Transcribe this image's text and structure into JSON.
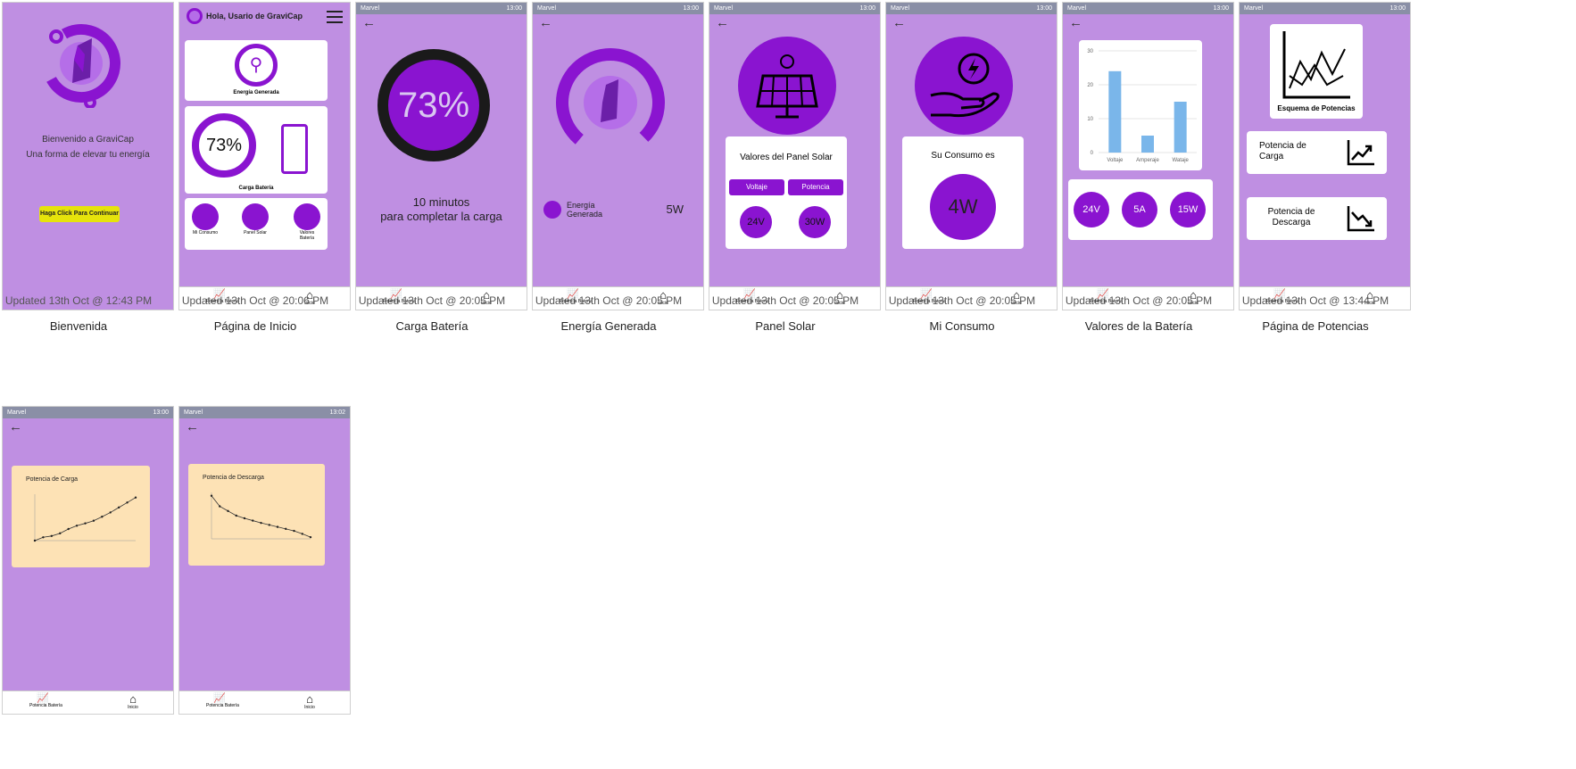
{
  "screens": [
    {
      "updated": "Updated 13th Oct @ 12:43 PM",
      "title": "Bienvenida"
    },
    {
      "updated": "Updated 13th Oct @ 20:06 PM",
      "title": "Página de Inicio"
    },
    {
      "updated": "Updated 13th Oct @ 20:05 PM",
      "title": "Carga Batería"
    },
    {
      "updated": "Updated 13th Oct @ 20:05 PM",
      "title": "Energía Generada"
    },
    {
      "updated": "Updated 13th Oct @ 20:05 PM",
      "title": "Panel Solar"
    },
    {
      "updated": "Updated 13th Oct @ 20:05 PM",
      "title": "Mi Consumo"
    },
    {
      "updated": "Updated 13th Oct @ 20:05 PM",
      "title": "Valores de la Batería"
    },
    {
      "updated": "Updated 13th Oct @ 13:44 PM",
      "title": "Página de Potencias"
    }
  ],
  "statusbar": {
    "carrier": "Marvel",
    "time": "13:00",
    "time2": "13:02"
  },
  "nav": {
    "left": "Potencia Batería",
    "right": "Inicio"
  },
  "welcome": {
    "line1": "Bienvenido a GraviCap",
    "line2": "Una forma de elevar tu energía",
    "button": "Haga Click Para Continuar"
  },
  "home": {
    "greeting": "Hola, Usario de GraviCap",
    "energy_label": "Energía Generada",
    "battery_pct": "73%",
    "battery_label": "Carga Batería",
    "tiles": [
      "Mi Consumo",
      "Panel Solar",
      "Valores Batería"
    ]
  },
  "charge": {
    "pct": "73%",
    "line1": "10 minutos",
    "line2": "para completar la carga"
  },
  "energy": {
    "label1": "Energía",
    "label2": "Generada",
    "value": "5W"
  },
  "solar": {
    "heading": "Valores del Panel Solar",
    "btn_volt": "Voltaje",
    "btn_pow": "Potencia",
    "volt": "24V",
    "pow": "30W"
  },
  "consumo": {
    "heading": "Su Consumo es",
    "value": "4W"
  },
  "bateria": {
    "v": "24V",
    "a": "5A",
    "w": "15W",
    "yticks": [
      "30",
      "20",
      "10",
      "0"
    ],
    "xlabels": [
      "Voltaje",
      "Amperaje",
      "Wataje"
    ]
  },
  "potencias": {
    "esquema": "Esquema de Potencias",
    "carga": "Potencia de Carga",
    "descarga": "Potencia de Descarga"
  },
  "colors": {
    "purple": "#8a14d0",
    "bg": "#bf8fe2",
    "yellow": "#e6e30b",
    "cream": "#fde2b5",
    "bar": "#7ab6ea"
  },
  "chart_data": [
    {
      "type": "bar",
      "categories": [
        "Voltaje",
        "Amperaje",
        "Wataje"
      ],
      "values": [
        24,
        5,
        15
      ],
      "ylim": [
        0,
        30
      ],
      "xlabel": "",
      "ylabel": ""
    },
    {
      "type": "line",
      "title": "Potencia de Carga",
      "x": [
        0,
        1,
        2,
        3,
        4,
        5,
        6,
        7,
        8,
        9,
        10,
        11,
        12
      ],
      "values": [
        0,
        10,
        14,
        22,
        35,
        45,
        52,
        60,
        72,
        85,
        100,
        115,
        130
      ],
      "ylim": [
        0,
        140
      ]
    },
    {
      "type": "line",
      "title": "Potencia de Descarga",
      "x": [
        0,
        1,
        2,
        3,
        4,
        5,
        6,
        7,
        8,
        9,
        10,
        11,
        12
      ],
      "values": [
        130,
        98,
        84,
        70,
        62,
        55,
        48,
        42,
        36,
        30,
        24,
        15,
        5
      ],
      "ylim": [
        0,
        140
      ]
    }
  ]
}
